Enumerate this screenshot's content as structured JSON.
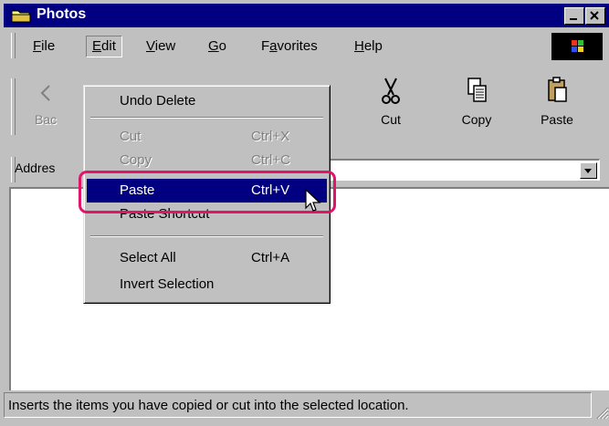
{
  "window": {
    "title": "Photos"
  },
  "menubar": {
    "items": [
      {
        "label": "File",
        "mnemonic": "F"
      },
      {
        "label": "Edit",
        "mnemonic": "E"
      },
      {
        "label": "View",
        "mnemonic": "V"
      },
      {
        "label": "Go",
        "mnemonic": "G"
      },
      {
        "label": "Favorites",
        "mnemonic": "a"
      },
      {
        "label": "Help",
        "mnemonic": "H"
      }
    ]
  },
  "toolbar": {
    "back_label": "Bac",
    "cut_label": "Cut",
    "copy_label": "Copy",
    "paste_label": "Paste"
  },
  "address": {
    "label": "Addres",
    "value": ""
  },
  "edit_menu": {
    "items": [
      {
        "label": "Undo Delete",
        "shortcut": "",
        "enabled": true
      },
      {
        "label": "Cut",
        "shortcut": "Ctrl+X",
        "enabled": false
      },
      {
        "label": "Copy",
        "shortcut": "Ctrl+C",
        "enabled": false
      },
      {
        "label": "Paste",
        "shortcut": "Ctrl+V",
        "enabled": true,
        "highlighted": true
      },
      {
        "label": "Paste Shortcut",
        "shortcut": "",
        "enabled": true
      },
      {
        "label": "Select All",
        "shortcut": "Ctrl+A",
        "enabled": true
      },
      {
        "label": "Invert Selection",
        "shortcut": "",
        "enabled": true
      }
    ]
  },
  "statusbar": {
    "text": "Inserts the items you have copied or cut into the selected location."
  },
  "colors": {
    "titlebar": "#000080",
    "face": "#c0c0c0",
    "highlight": "#000080",
    "callout": "#e0156a"
  }
}
